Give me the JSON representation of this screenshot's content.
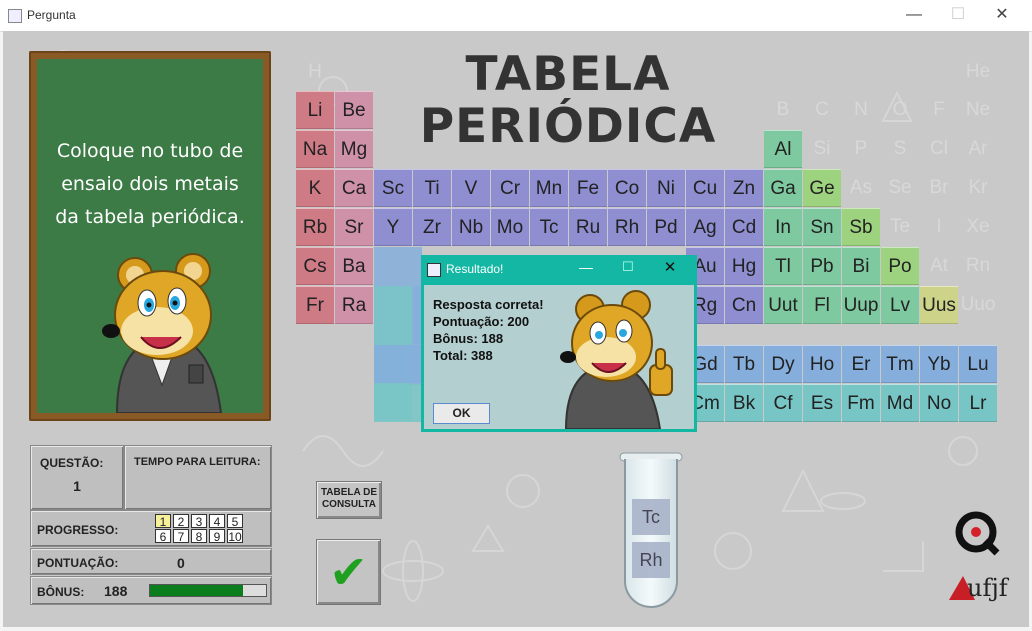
{
  "window": {
    "title": "Pergunta",
    "minimize_glyph": "—",
    "maximize_glyph": "☐",
    "close_glyph": "✕"
  },
  "board": {
    "instruction": "Coloque no tubo de ensaio dois metais da tabela periódica."
  },
  "header": {
    "title_line1": "TABELA",
    "title_line2": "PERIÓDICA"
  },
  "periodic_table": {
    "visible_elements": [
      "H",
      "He",
      "Li",
      "Be",
      "B",
      "C",
      "N",
      "O",
      "F",
      "Ne",
      "Na",
      "Mg",
      "Al",
      "Si",
      "P",
      "S",
      "Cl",
      "Ar",
      "K",
      "Ca",
      "Sc",
      "Ti",
      "V",
      "Cr",
      "Mn",
      "Fe",
      "Co",
      "Ni",
      "Cu",
      "Zn",
      "Ga",
      "Ge",
      "As",
      "Se",
      "Br",
      "Kr",
      "Rb",
      "Sr",
      "Y",
      "Zr",
      "Nb",
      "Mo",
      "Tc",
      "Ru",
      "Rh",
      "Pd",
      "Ag",
      "Cd",
      "In",
      "Sn",
      "Sb",
      "Te",
      "I",
      "Xe",
      "Cs",
      "Ba",
      "Au",
      "Hg",
      "Tl",
      "Pb",
      "Bi",
      "Po",
      "At",
      "Rn",
      "Fr",
      "Ra",
      "Rg",
      "Cn",
      "Uut",
      "Fl",
      "Uup",
      "Lv",
      "Uus",
      "Uuo",
      "Gd",
      "Tb",
      "Dy",
      "Ho",
      "Er",
      "Tm",
      "Yb",
      "Lu",
      "Cm",
      "Bk",
      "Cf",
      "Es",
      "Fm",
      "Md",
      "No",
      "Lr"
    ],
    "colors": {
      "alkali": "#cf7b86",
      "alkaline_earth": "#cf91a8",
      "transition": "#8f8ed1",
      "post_transition": "#7fc9a0",
      "metalloid": "#9dd37f",
      "nonmetal_faded": "#c9c9c9",
      "uus": "#cdd48a",
      "lanthanide": "#85aedc",
      "actinide": "#78c5c5"
    }
  },
  "stats": {
    "question_label": "QUESTÃO:",
    "question_value": "1",
    "reading_time_label": "TEMPO PARA LEITURA:",
    "progress_label": "PROGRESSO:",
    "progress_boxes": [
      "1",
      "2",
      "3",
      "4",
      "5",
      "6",
      "7",
      "8",
      "9",
      "10"
    ],
    "progress_current": "1",
    "score_label": "PONTUAÇÃO:",
    "score_value": "0",
    "bonus_label": "BÔNUS:",
    "bonus_value": "188",
    "bonus_fraction": 0.8
  },
  "buttons": {
    "reference_table_line1": "TABELA DE",
    "reference_table_line2": "CONSULTA",
    "confirm_glyph": "✔"
  },
  "test_tube": {
    "items": [
      "Tc",
      "Rh"
    ]
  },
  "dialog": {
    "title": "Resultado!",
    "line1": "Resposta correta!",
    "line2": "Pontuação: 200",
    "line3": "Bônus: 188",
    "line4": "Total: 388",
    "ok_label": "OK"
  },
  "logos": {
    "lab_logo_icon": "q-logo-icon",
    "university_text": "ufjf"
  }
}
